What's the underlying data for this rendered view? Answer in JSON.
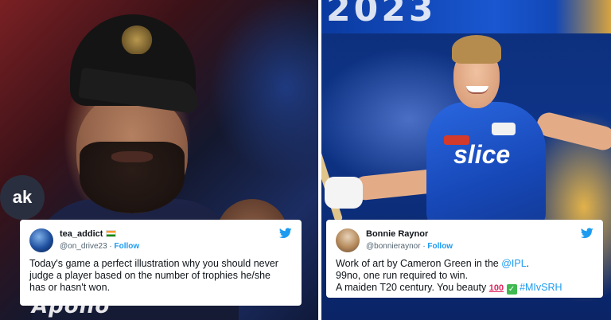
{
  "left_tweet": {
    "display_name": "tea_addict",
    "handle": "@on_drive23",
    "follow_label": "Follow",
    "text_lines": [
      "Today's game a perfect illustration why you should never",
      "judge a player based on the number of trophies he/she",
      "has or hasn't won."
    ],
    "icons": [
      "avatar",
      "india-flag-icon",
      "twitter-bird-icon"
    ]
  },
  "right_tweet": {
    "display_name": "Bonnie Raynor",
    "handle": "@bonnieraynor",
    "follow_label": "Follow",
    "line1_prefix": "Work of art by Cameron Green in the ",
    "line1_mention": "@IPL",
    "line1_suffix": ".",
    "line2": "99no, one run required to win.",
    "line3_prefix": "A maiden T20 century. You beauty ",
    "emoji_100": "100",
    "emoji_check": "✓",
    "hashtag": "#MIvSRH",
    "icons": [
      "avatar",
      "hundred-points-icon",
      "check-mark-icon",
      "twitter-bird-icon"
    ]
  },
  "photos": {
    "left_jersey_text": "Apollo",
    "left_mic_text": "ak",
    "right_banner_text": "2023",
    "right_jersey_text": "slice"
  },
  "colors": {
    "twitter_blue": "#1d9bf0",
    "handle_gray": "#536471",
    "text_dark": "#0f1419",
    "mi_blue": "#1748b8"
  }
}
